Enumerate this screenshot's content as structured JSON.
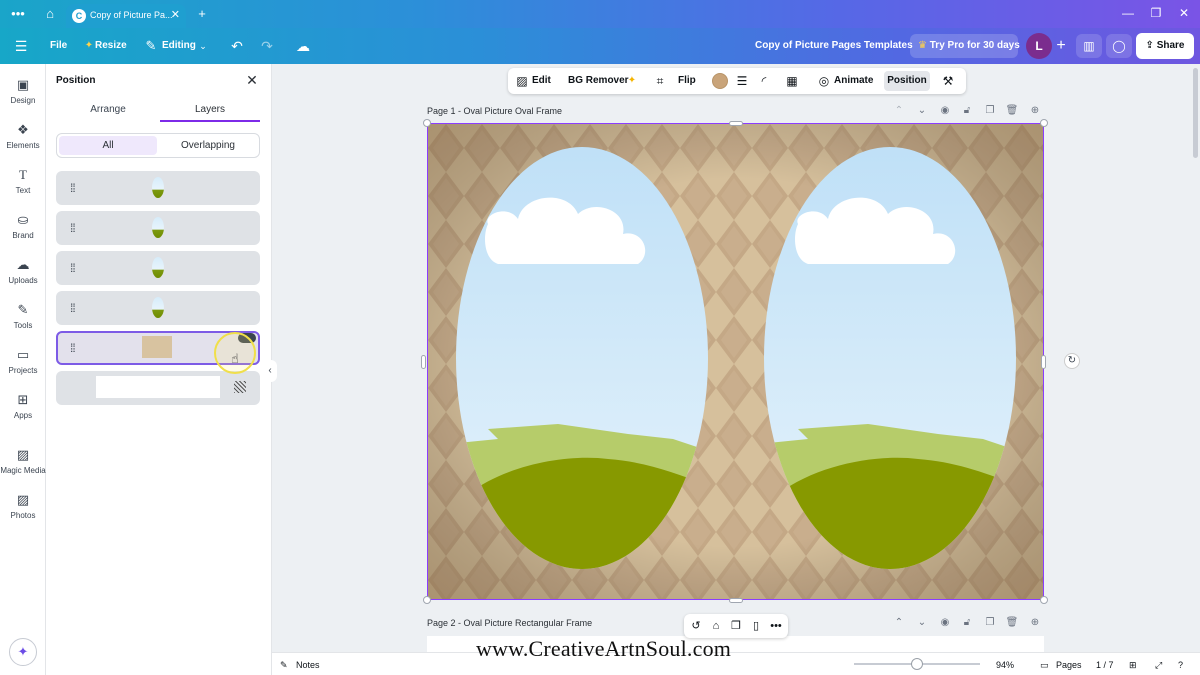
{
  "browser": {
    "tab_title": "Copy of Picture Pa...",
    "tab_favicon_letter": "C",
    "menu_icon": "more-icon",
    "home_icon": "home-icon",
    "new_tab_icon": "plus-icon",
    "close_icon": "close-icon"
  },
  "header": {
    "file_label": "File",
    "resize_label": "Resize",
    "editing_label": "Editing",
    "doc_title": "Copy of Picture Pages Templates",
    "pro_label": "Try Pro for 30 days",
    "avatar_letter": "L",
    "share_label": "Share",
    "accent_gradient": [
      "#17a7c8",
      "#5268e2",
      "#6e57e0"
    ]
  },
  "rail": {
    "items": [
      {
        "label": "Design",
        "icon": "layout-icon"
      },
      {
        "label": "Elements",
        "icon": "shapes-icon"
      },
      {
        "label": "Text",
        "icon": "text-icon"
      },
      {
        "label": "Brand",
        "icon": "brand-icon"
      },
      {
        "label": "Uploads",
        "icon": "cloud-upload-icon"
      },
      {
        "label": "Tools",
        "icon": "pen-icon"
      },
      {
        "label": "Projects",
        "icon": "folder-icon"
      },
      {
        "label": "Apps",
        "icon": "apps-icon"
      },
      {
        "label": "Magic Media",
        "icon": "magic-media-icon"
      },
      {
        "label": "Photos",
        "icon": "photo-icon"
      }
    ]
  },
  "panel": {
    "title": "Position",
    "tabs": [
      {
        "label": "Arrange",
        "active": false
      },
      {
        "label": "Layers",
        "active": true
      }
    ],
    "filters": [
      {
        "label": "All",
        "selected": true
      },
      {
        "label": "Overlapping",
        "selected": false
      }
    ],
    "layers": [
      {
        "kind": "oval"
      },
      {
        "kind": "oval"
      },
      {
        "kind": "oval"
      },
      {
        "kind": "oval"
      },
      {
        "kind": "background",
        "selected": true
      },
      {
        "kind": "white-rect"
      }
    ]
  },
  "toolbar": {
    "edit_label": "Edit",
    "bg_remover_label": "BG Remover",
    "flip_label": "Flip",
    "animate_label": "Animate",
    "position_label": "Position",
    "fill_color": "#c9a47a"
  },
  "canvas": {
    "page1_label": "Page 1 - Oval Picture Oval Frame",
    "page2_label": "Page 2 - Oval Picture Rectangular Frame",
    "frame_border_color": "#8b3dff",
    "sky_color": "#cfe7f8",
    "grass_color": "#8a9a00",
    "background_color": "#d8c3a0"
  },
  "footer": {
    "notes_label": "Notes",
    "zoom_percent": "94%",
    "zoom_level": 0.5,
    "pages_label": "Pages",
    "page_count": "1 / 7"
  },
  "watermark": "www.CreativeArtnSoul.com"
}
